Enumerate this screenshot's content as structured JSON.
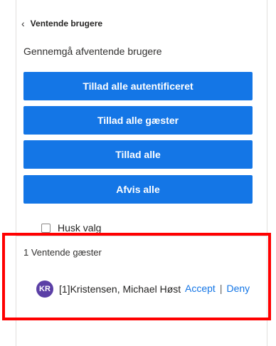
{
  "header": {
    "back_icon": "chevron-left-icon",
    "back_glyph": "‹",
    "title": "Ventende brugere"
  },
  "subtitle": "Gennemgå afventende brugere",
  "buttons": {
    "allow_authenticated": "Tillad alle autentificeret",
    "allow_guests": "Tillad alle gæster",
    "allow_all": "Tillad alle",
    "deny_all": "Afvis alle"
  },
  "remember": {
    "label": "Husk valg",
    "checked": false
  },
  "guests": {
    "heading": "1 Ventende gæster",
    "items": [
      {
        "initials": "KR",
        "name": "[1]Kristensen, Michael Høst",
        "accept_label": "Accept",
        "separator": "|",
        "deny_label": "Deny"
      }
    ]
  },
  "colors": {
    "primary_button": "#1476e6",
    "link": "#1476e6",
    "avatar": "#5b3fa6",
    "highlight_box": "#ff0000"
  }
}
